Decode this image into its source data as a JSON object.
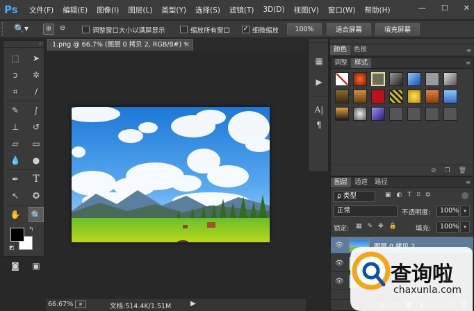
{
  "app": {
    "logo": "Ps"
  },
  "menu": [
    "文件(F)",
    "编辑(E)",
    "图像(I)",
    "图层(L)",
    "类型(Y)",
    "选择(S)",
    "滤镜(T)",
    "3D(D)",
    "视图(V)",
    "窗口(W)",
    "帮助(H)"
  ],
  "window_controls": {
    "minimize": "—",
    "restore": "☐",
    "close": "✕"
  },
  "options": {
    "resize_window_label": "调整窗口大小以满屏显示",
    "resize_window_checked": false,
    "zoom_all_label": "缩放所有窗口",
    "zoom_all_checked": false,
    "scrubby_zoom_label": "细微缩放",
    "scrubby_zoom_checked": true,
    "zoom_value": "100%",
    "fit_screen": "适合屏幕",
    "fill_screen": "填充屏幕"
  },
  "document": {
    "tab_title": "1.png @ 66.7% (图层 0 拷贝 2, RGB/8#) *",
    "close": "×"
  },
  "status": {
    "zoom": "66.67%",
    "doc_info": "文档:514.4K/1.51M"
  },
  "top_panel": {
    "tabs": [
      "颜色",
      "色板"
    ]
  },
  "styles_panel": {
    "tabs": [
      "调整",
      "样式"
    ],
    "active_tab": "样式"
  },
  "layers_panel": {
    "tabs": [
      "图层",
      "通道",
      "路径"
    ],
    "filter": "ρ 类型",
    "blend_mode": "正常",
    "opacity_label": "不透明度:",
    "opacity_value": "100%",
    "lock_label": "锁定:",
    "fill_label": "填充:",
    "fill_value": "100%",
    "layers": [
      {
        "name": "图层 0 拷贝 2",
        "selected": true
      },
      {
        "name": "",
        "selected": false
      },
      {
        "name": "",
        "selected": false
      }
    ]
  },
  "watermark": {
    "text": "查询啦",
    "url": "chaxunla.com"
  },
  "colors": {
    "accent": "#4aa7ff",
    "ui_dark": "#282828",
    "panel": "#3a3a3a",
    "watermark_orange": "#f5a51c"
  }
}
